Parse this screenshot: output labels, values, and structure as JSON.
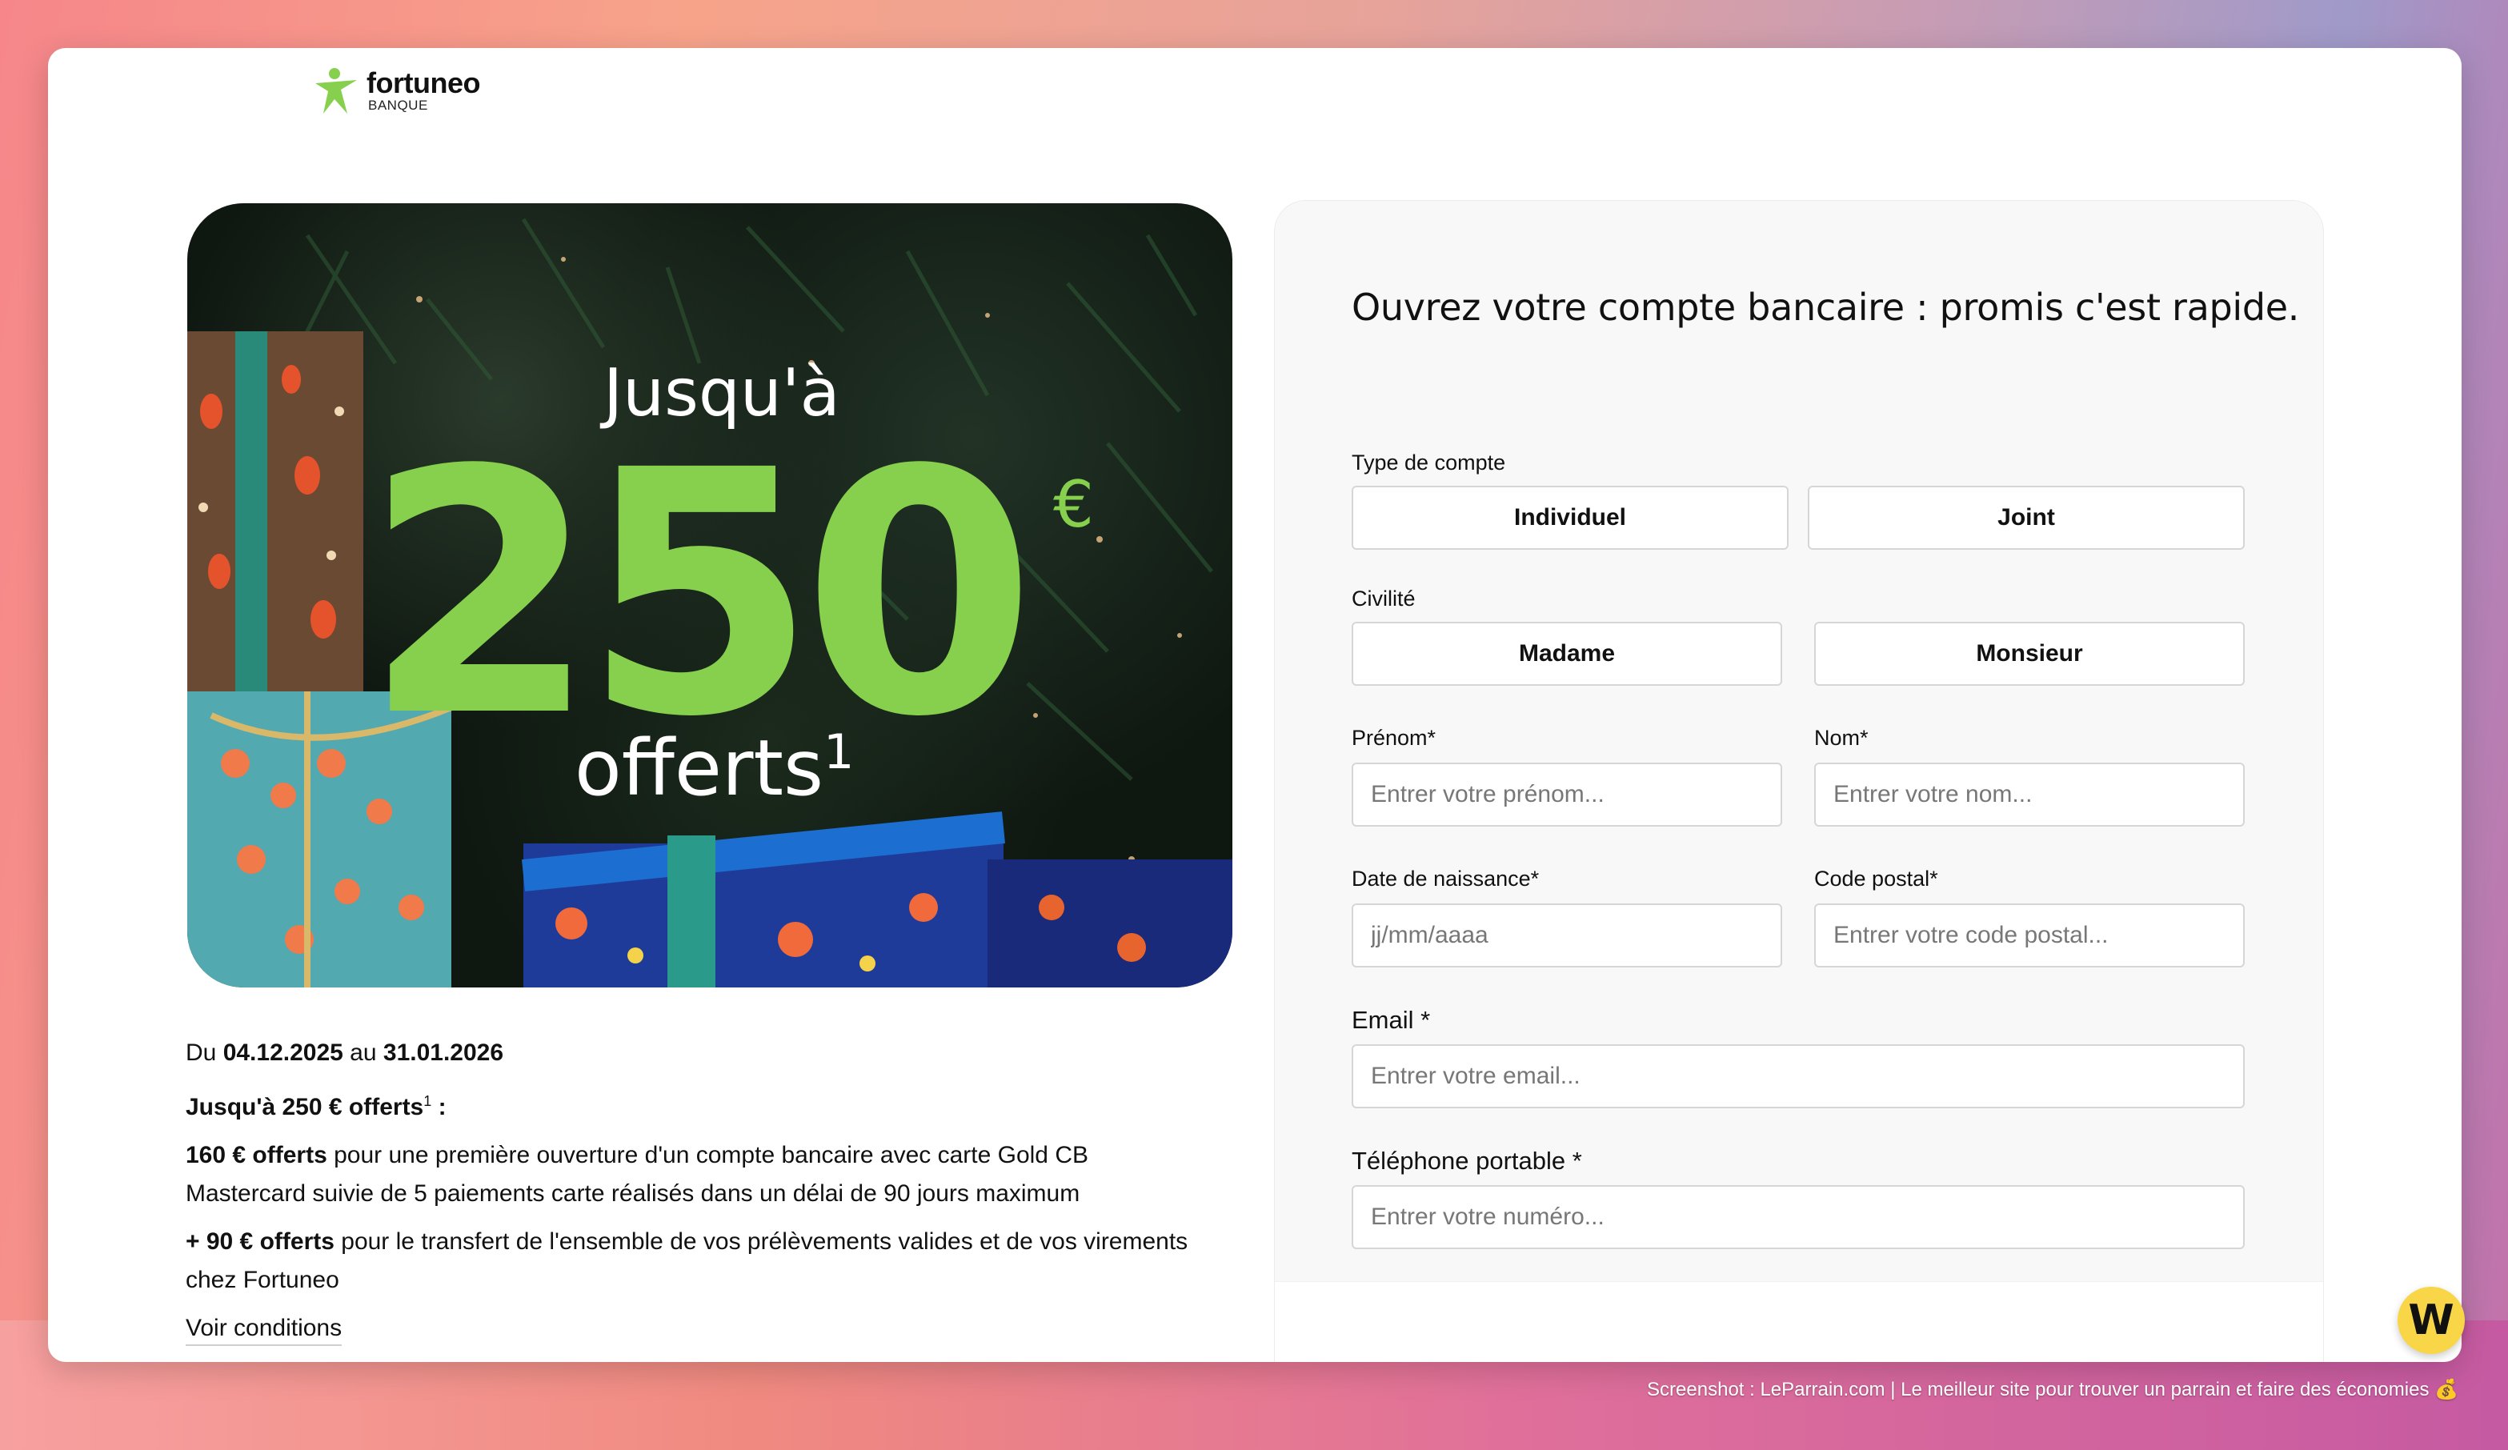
{
  "logo": {
    "name": "fortuneo",
    "sub": "BANQUE"
  },
  "hero": {
    "jusqua": "Jusqu'à",
    "amount": "250",
    "currency": "€",
    "offerts": "offerts",
    "note": "1"
  },
  "promo": {
    "period_prefix": "Du ",
    "period_start": "04.12.2025",
    "period_mid": " au ",
    "period_end": "31.01.2026",
    "headline": "Jusqu'à 250 € offerts",
    "headline_note": "1",
    "headline_suffix": " :",
    "offer1_strong": "160 € offerts",
    "offer1_text": " pour une première ouverture d'un compte bancaire avec carte Gold CB Mastercard suivie de 5 paiements carte réalisés dans un délai de 90 jours maximum",
    "offer2_strong": "+ 90 € offerts",
    "offer2_text": " pour le transfert de l'ensemble de vos prélèvements valides et de vos virements chez Fortuneo",
    "conditions_link": "Voir conditions"
  },
  "form": {
    "title": "Ouvrez votre compte bancaire : promis c'est rapide.",
    "account_type_label": "Type de compte",
    "account_type_options": [
      "Individuel",
      "Joint"
    ],
    "civility_label": "Civilité",
    "civility_options": [
      "Madame",
      "Monsieur"
    ],
    "firstname_label": "Prénom*",
    "firstname_placeholder": "Entrer votre prénom...",
    "lastname_label": "Nom*",
    "lastname_placeholder": "Entrer votre nom...",
    "birthdate_label": "Date de naissance*",
    "birthdate_placeholder": "jj/mm/aaaa",
    "postal_label": "Code postal*",
    "postal_placeholder": "Entrer votre code postal...",
    "email_label": "Email *",
    "email_placeholder": "Entrer votre email...",
    "phone_label": "Téléphone portable *",
    "phone_placeholder": "Entrer votre numéro..."
  },
  "widget": {
    "letter": "W"
  },
  "footer": {
    "text": "Screenshot : LeParrain.com | Le meilleur site pour trouver un parrain et faire des économies 💰"
  },
  "colors": {
    "brand_green": "#86d04e",
    "widget_yellow": "#f8d648"
  }
}
